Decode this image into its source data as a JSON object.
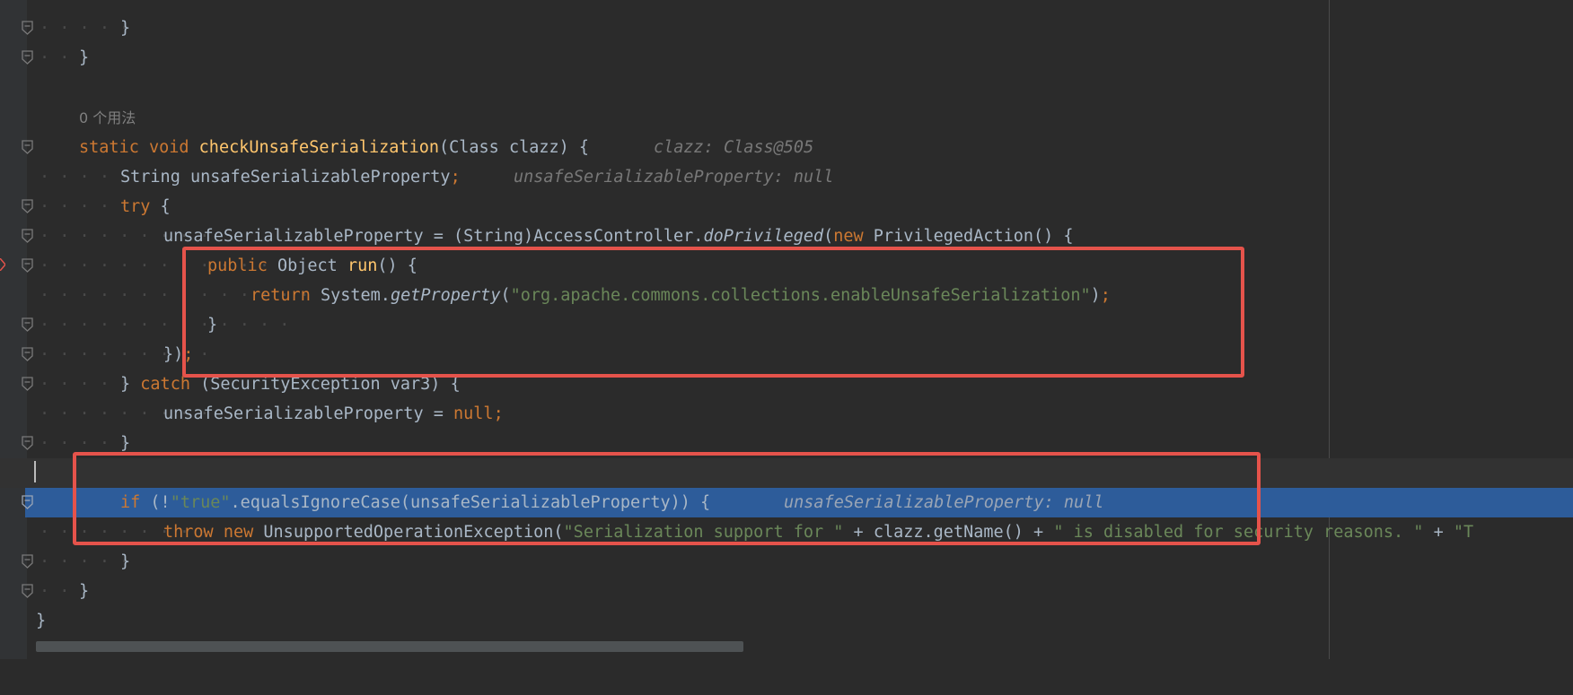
{
  "editor": {
    "usage_hint": "0 个用法",
    "lines": {
      "l1": "}",
      "l2": "}",
      "l4_a": "static",
      "l4_b": "void",
      "l4_fn": "checkUnsafeSerialization",
      "l4_c": "(Class clazz) {",
      "l4_hint": "clazz: Class@505",
      "l5_a": "String unsafeSerializableProperty",
      "l5_semi": ";",
      "l5_hint": "unsafeSerializableProperty: null",
      "l6_kw": "try",
      "l6_b": " {",
      "l7_a": "unsafeSerializableProperty = (String)AccessController.",
      "l7_it": "doPrivileged",
      "l7_b": "(",
      "l7_kw": "new",
      "l7_c": " PrivilegedAction() {",
      "l8_kw": "public",
      "l8_a": " Object ",
      "l8_fn": "run",
      "l8_b": "() {",
      "l9_kw": "return",
      "l9_a": " System.",
      "l9_it": "getProperty",
      "l9_b": "(",
      "l9_str": "\"org.apache.commons.collections.enableUnsafeSerialization\"",
      "l9_c": ")",
      "l9_semi": ";",
      "l10": "}",
      "l11_a": "})",
      "l11_semi": ";",
      "l12_a": "} ",
      "l12_kw": "catch",
      "l12_b": " (SecurityException var3) {",
      "l13_a": "unsafeSerializableProperty = ",
      "l13_kw": "null",
      "l13_semi": ";",
      "l14": "}",
      "l16_kw": "if",
      "l16_a": " (!",
      "l16_str": "\"true\"",
      "l16_b": ".equalsIgnoreCase(unsafeSerializableProperty)) {",
      "l16_hint": "unsafeSerializableProperty: null",
      "l17_kw1": "throw",
      "l17_kw2": "new",
      "l17_a": " UnsupportedOperationException(",
      "l17_str1": "\"Serialization support for \"",
      "l17_b": " + clazz.getName() + ",
      "l17_str2": "\" is disabled for security reasons. \"",
      "l17_c": " + ",
      "l17_str3": "\"T",
      "l18": "}",
      "l19": "}",
      "l20": "}"
    }
  },
  "colors": {
    "background": "#2b2b2b",
    "keyword": "#cc7832",
    "string": "#6a8759",
    "function": "#ffc66d",
    "highlight": "#2d5c9a",
    "annotation_box": "#e5534b"
  },
  "icons": [
    "fold-icon",
    "breakpoint-arrow-icon"
  ]
}
